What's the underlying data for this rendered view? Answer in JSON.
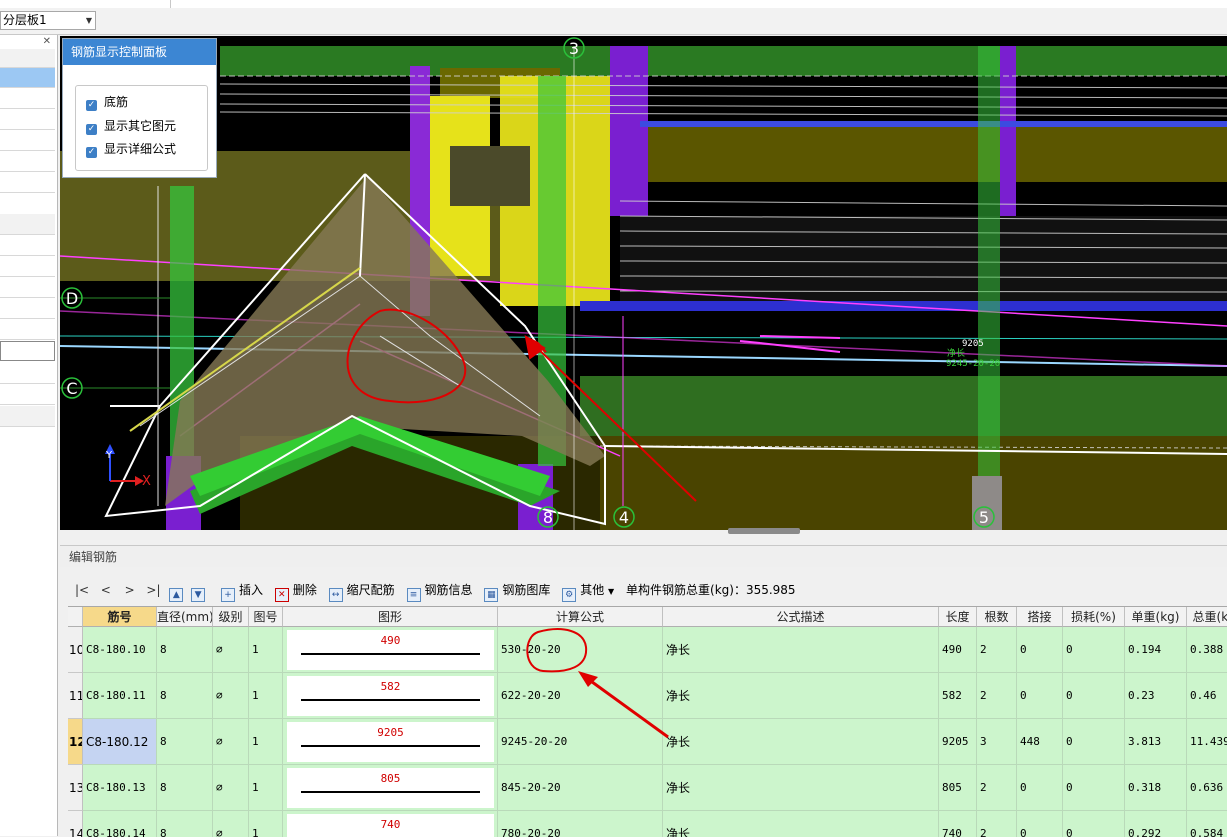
{
  "toolbar": {
    "layer_select_value": "分层板1"
  },
  "control_panel": {
    "title": "钢筋显示控制面板",
    "options": [
      {
        "label": "底筋",
        "checked": true
      },
      {
        "label": "显示其它图元",
        "checked": true
      },
      {
        "label": "显示详细公式",
        "checked": true
      }
    ]
  },
  "viewport": {
    "axis_labels": {
      "a3": "3",
      "a4": "4",
      "a5": "5",
      "aD": "D",
      "aC": "C",
      "a8": "8"
    },
    "annotation": {
      "value": "9205",
      "desc": "净长",
      "formula": "9245-20-20"
    },
    "coord_axes": {
      "y": "Y",
      "x": "X"
    }
  },
  "edit_panel": {
    "title": "编辑钢筋"
  },
  "rebar_toolbar": {
    "nav_first": "|<",
    "nav_prev": "<",
    "nav_next": ">",
    "nav_last": ">|",
    "insert": "插入",
    "delete": "删除",
    "scale": "缩尺配筋",
    "info": "钢筋信息",
    "library": "钢筋图库",
    "other": "其他",
    "total_weight_label": "单构件钢筋总重(kg)：355.985"
  },
  "table": {
    "columns": [
      "筋号",
      "直径(mm)",
      "级别",
      "图号",
      "图形",
      "计算公式",
      "公式描述",
      "长度",
      "根数",
      "搭接",
      "损耗(%)",
      "单重(kg)",
      "总重(kg)"
    ],
    "rows": [
      {
        "num": "10",
        "bar_id": "C8-180.10",
        "diameter": "8",
        "grade": "⌀",
        "fig": "1",
        "shape_value": "490",
        "formula": "530-20-20",
        "desc": "净长",
        "length": "490",
        "count": "2",
        "lap": "0",
        "loss": "0",
        "unit_weight": "0.194",
        "total_weight": "0.388"
      },
      {
        "num": "11",
        "bar_id": "C8-180.11",
        "diameter": "8",
        "grade": "⌀",
        "fig": "1",
        "shape_value": "582",
        "formula": "622-20-20",
        "desc": "净长",
        "length": "582",
        "count": "2",
        "lap": "0",
        "loss": "0",
        "unit_weight": "0.23",
        "total_weight": "0.46"
      },
      {
        "num": "12",
        "bar_id": "C8-180.12",
        "diameter": "8",
        "grade": "⌀",
        "fig": "1",
        "shape_value": "9205",
        "formula": "9245-20-20",
        "desc": "净长",
        "length": "9205",
        "count": "3",
        "lap": "448",
        "loss": "0",
        "unit_weight": "3.813",
        "total_weight": "11.439"
      },
      {
        "num": "13",
        "bar_id": "C8-180.13",
        "diameter": "8",
        "grade": "⌀",
        "fig": "1",
        "shape_value": "805",
        "formula": "845-20-20",
        "desc": "净长",
        "length": "805",
        "count": "2",
        "lap": "0",
        "loss": "0",
        "unit_weight": "0.318",
        "total_weight": "0.636"
      },
      {
        "num": "14",
        "bar_id": "C8-180.14",
        "diameter": "8",
        "grade": "⌀",
        "fig": "1",
        "shape_value": "740",
        "formula": "780-20-20",
        "desc": "净长",
        "length": "740",
        "count": "2",
        "lap": "0",
        "loss": "0",
        "unit_weight": "0.292",
        "total_weight": "0.584"
      }
    ]
  },
  "colors": {
    "accent": "#3c86d3",
    "row_bg": "#ccf5cc",
    "selected_cell": "#c5d4f2",
    "active_header": "#f6d98a",
    "annotation_red": "#e00000"
  }
}
